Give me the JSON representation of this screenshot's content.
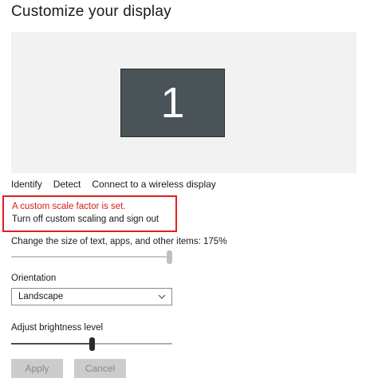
{
  "page": {
    "title": "Customize your display"
  },
  "display": {
    "monitor_number": "1",
    "links": {
      "identify": "Identify",
      "detect": "Detect",
      "connect": "Connect to a wireless display"
    }
  },
  "warning": {
    "message": "A custom scale factor is set.",
    "action": "Turn off custom scaling and sign out"
  },
  "scale": {
    "label": "Change the size of text, apps, and other items: 175%",
    "value_fraction": 1.0
  },
  "orientation": {
    "label": "Orientation",
    "selected": "Landscape"
  },
  "brightness": {
    "label": "Adjust brightness level",
    "value_fraction": 0.5
  },
  "buttons": {
    "apply": "Apply",
    "cancel": "Cancel"
  },
  "colors": {
    "warning_border": "#e01e1e",
    "warning_text": "#d81b1b",
    "monitor": "#4a5358",
    "button_disabled": "#cccccc"
  }
}
